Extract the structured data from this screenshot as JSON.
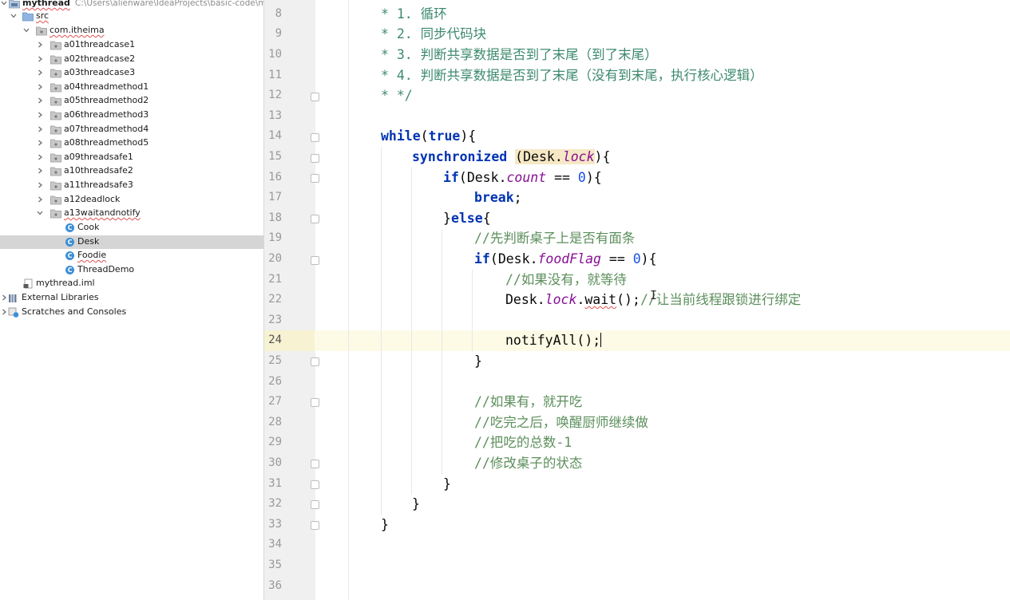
{
  "project": {
    "root_name": "mythread",
    "root_path": "C:\\Users\\alienware\\IdeaProjects\\basic-code\\myt",
    "src": "src",
    "package": "com.itheima",
    "folders": [
      "a01threadcase1",
      "a02threadcase2",
      "a03threadcase3",
      "a04threadmethod1",
      "a05threadmethod2",
      "a06threadmethod3",
      "a07threadmethod4",
      "a08threadmethod5",
      "a09threadsafe1",
      "a10threadsafe2",
      "a11threadsafe3",
      "a12deadlock",
      "a13waitandnotify"
    ],
    "classes": [
      "Cook",
      "Desk",
      "Foodie",
      "ThreadDemo"
    ],
    "selected_class": "Desk",
    "iml_file": "mythread.iml",
    "external_libraries": "External Libraries",
    "scratches": "Scratches and Consoles"
  },
  "editor": {
    "current_line": 24,
    "line_numbers": [
      "8",
      "9",
      "10",
      "11",
      "12",
      "13",
      "14",
      "15",
      "16",
      "17",
      "18",
      "19",
      "20",
      "21",
      "22",
      "23",
      "24",
      "25",
      "26",
      "27",
      "28",
      "29",
      "30",
      "31",
      "32",
      "33",
      "34",
      "35",
      "36"
    ],
    "code": {
      "l8": "* 1. 循环",
      "l9": "* 2. 同步代码块",
      "l10": "* 3. 判断共享数据是否到了末尾（到了末尾）",
      "l11": "* 4. 判断共享数据是否到了末尾（没有到末尾，执行核心逻辑）",
      "l12": "* */",
      "while_kw": "while",
      "true_kw": "true",
      "l14_rest": "){",
      "synchronized_kw": "synchronized",
      "desk": "Desk",
      "lock": "lock",
      "count": "count",
      "foodFlag": "foodFlag",
      "zero": "0",
      "if_kw": "if",
      "break_kw": "break",
      "else_kw": "else",
      "l19": "//先判断桌子上是否有面条",
      "l21": "//如果没有，就等待",
      "wait_call": "wait",
      "l22_comment": "//让当前线程跟锁进行绑定",
      "l24": "notifyAll();",
      "l27": "//如果有，就开吃",
      "l28": "//吃完之后，唤醒厨师继续做",
      "l29": "//把吃的总数-1",
      "l30": "//修改桌子的状态"
    }
  }
}
